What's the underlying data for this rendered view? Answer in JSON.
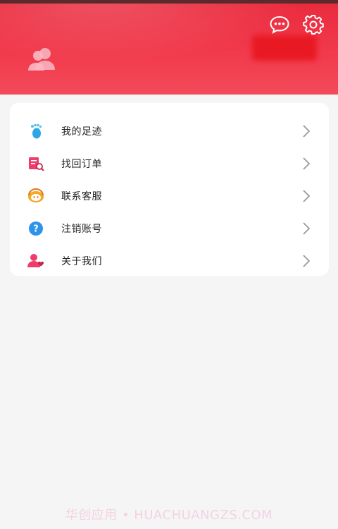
{
  "menu": {
    "items": [
      {
        "label": "我的足迹",
        "icon": "footprint-icon"
      },
      {
        "label": "找回订单",
        "icon": "order-search-icon"
      },
      {
        "label": "联系客服",
        "icon": "customer-service-icon"
      },
      {
        "label": "注销账号",
        "icon": "help-question-icon"
      },
      {
        "label": "关于我们",
        "icon": "about-us-icon"
      }
    ]
  },
  "watermark": "华创应用 • HUACHUANGZS.COM",
  "colors": {
    "header": "#ee3345",
    "background": "#f5f5f5",
    "card": "#ffffff",
    "chevron": "#999999"
  }
}
